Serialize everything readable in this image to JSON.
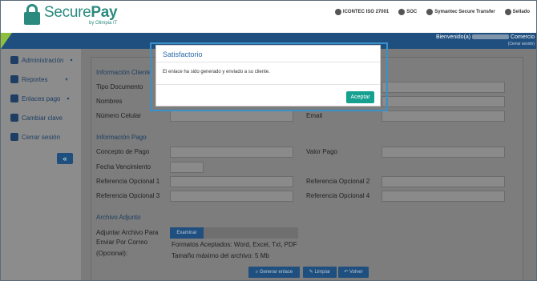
{
  "header": {
    "logo_main_a": "Secure",
    "logo_main_b": "Pay",
    "logo_sub": "by Olimpia IT",
    "certs": [
      "ICONTEC ISO 27001",
      "SOC",
      "Symantec Secure Transfer",
      "Sellado"
    ]
  },
  "navbar": {
    "welcome_prefix": "Bienvenido(a)",
    "welcome_suffix": "Comercio",
    "logout_hint": "(Cerrar sesión)"
  },
  "sidebar": {
    "items": [
      {
        "label": "Administración",
        "icon": "gear-icon",
        "caret": "▾"
      },
      {
        "label": "Reportes",
        "icon": "report-icon",
        "caret": "▾"
      },
      {
        "label": "Enlaces pago",
        "icon": "link-icon",
        "caret": "▾"
      },
      {
        "label": "Cambiar clave",
        "icon": "lock-icon",
        "caret": ""
      },
      {
        "label": "Cerrar sesión",
        "icon": "logout-icon",
        "caret": ""
      }
    ],
    "collapse": "«"
  },
  "form": {
    "section_client": "Información Cliente",
    "tipo_documento": "Tipo Documento",
    "nombres": "Nombres",
    "numero_celular": "Número Celular",
    "email": "Email",
    "section_pago": "Información Pago",
    "concepto_pago": "Concepto de Pago",
    "valor_pago": "Valor Pago",
    "fecha_vencimiento": "Fecha Vencimiento",
    "ref1": "Referencia Opcional 1",
    "ref2": "Referencia Opcional 2",
    "ref3": "Referencia Opcional 3",
    "ref4": "Referencia Opcional 4",
    "section_archivo": "Archivo Adjunto",
    "adjuntar_1": "Adjuntar Archivo Para",
    "adjuntar_2": "Enviar Por Correo",
    "adjuntar_3": "(Opcional):",
    "examinar": "Examinar",
    "formatos": "Formatos Aceptados: Word, Excel, Txt, PDF",
    "tamano": "Tamaño máximo del archivo: 5 Mb",
    "btn_generar": "Generar enlace",
    "btn_limpiar": "Limpiar",
    "btn_volver": "Volver"
  },
  "modal": {
    "title": "Satisfactorio",
    "message": "El enlace ha sido generado y enviado a su cliente.",
    "accept": "Aceptar"
  },
  "colors": {
    "brand": "#2b8a7e",
    "navbar": "#1f4f7e",
    "accent_green": "#8fbf3f",
    "modal_button": "#16a08f",
    "modal_title": "#2b6aa8"
  }
}
